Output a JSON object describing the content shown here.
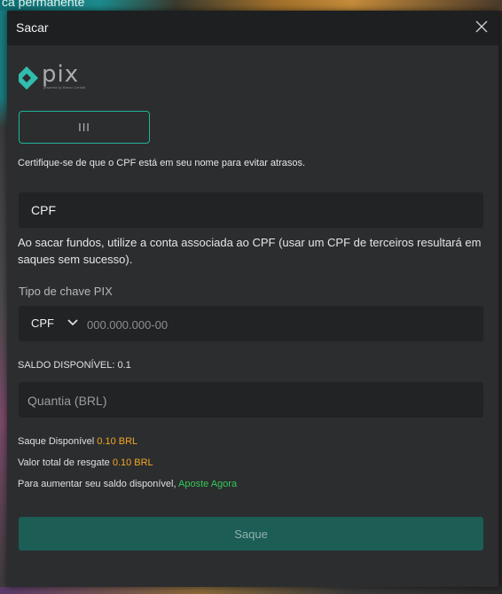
{
  "background": {
    "top_text": "ca permanente"
  },
  "modal": {
    "title": "Sacar"
  },
  "logo": {
    "text": "pix",
    "tagline": "powered by Banco Central"
  },
  "method_tab": {
    "label": "III"
  },
  "notice": "Certifique-se de que o CPF está em seu nome para evitar atrasos.",
  "cpf_document": {
    "value": "CPF"
  },
  "warning": "Ao sacar fundos, utilize a conta associada ao CPF (usar um CPF de terceiros resultará em saques sem sucesso).",
  "pix_key": {
    "label": "Tipo de chave PIX",
    "type_selected": "CPF",
    "placeholder": "000.000.000-00"
  },
  "saldo": "SALDO DISPONÍVEL: 0.1",
  "amount": {
    "placeholder": "Quantia (BRL)"
  },
  "info": {
    "available_label": "Saque Disponível",
    "available_value": "0.10 BRL",
    "total_label": "Valor total de resgate",
    "total_value": "0.10 BRL",
    "increase_text": "Para aumentar seu saldo disponível,",
    "increase_link": "Aposte Agora"
  },
  "submit_label": "Saque",
  "colors": {
    "accent": "#1fb59a",
    "button": "#1c5d55",
    "highlight": "#f5a623",
    "link": "#34c759"
  }
}
